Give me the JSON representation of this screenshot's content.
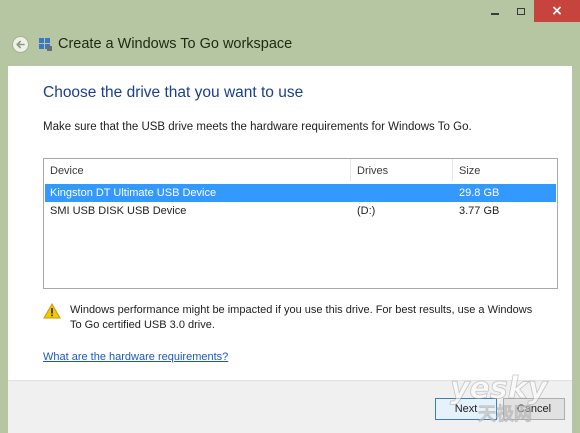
{
  "window": {
    "title": "Create a Windows To Go workspace",
    "caption": {
      "minimize": "minimize",
      "maximize": "maximize",
      "close": "×"
    }
  },
  "page": {
    "heading": "Choose the drive that you want to use",
    "instruction": "Make sure that the USB drive meets the hardware requirements for Windows To Go."
  },
  "drives_list": {
    "columns": [
      "Device",
      "Drives",
      "Size"
    ],
    "rows": [
      {
        "device": "Kingston DT Ultimate USB Device",
        "drive": "",
        "size": "29.8 GB",
        "selected": true
      },
      {
        "device": "SMI USB DISK USB Device",
        "drive": "(D:)",
        "size": "3.77 GB",
        "selected": false
      }
    ]
  },
  "warning": {
    "icon": "warning-triangle-icon",
    "text": "Windows performance might be impacted if you use this drive. For best results, use a Windows To Go certified USB 3.0 drive."
  },
  "link": {
    "label": "What are the hardware requirements?"
  },
  "footer": {
    "next_label": "Next",
    "cancel_label": "Cancel"
  },
  "watermark": {
    "latin": "yesky",
    "chinese": "天极网"
  },
  "colors": {
    "frame": "#b6c6a3",
    "heading": "#1b3f8b",
    "selection": "#3399ff",
    "close_button": "#c7433d",
    "link": "#1b57c2"
  }
}
